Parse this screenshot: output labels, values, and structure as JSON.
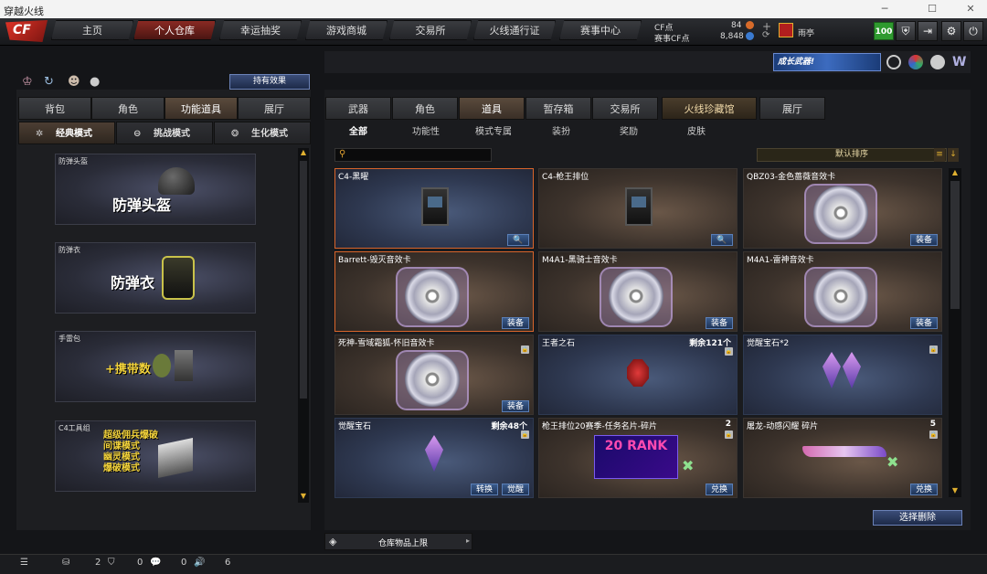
{
  "window": {
    "title": "穿越火线"
  },
  "nav": {
    "tabs": [
      "主页",
      "个人仓库",
      "幸运抽奖",
      "游戏商城",
      "交易所",
      "火线通行证",
      "赛事中心"
    ],
    "active": 1
  },
  "currency": {
    "cf_label": "CF点",
    "cf_value": "84",
    "match_label": "赛事CF点",
    "match_value": "8,848"
  },
  "user": {
    "name": "雨亭",
    "level": "100"
  },
  "left": {
    "effect_button": "持有效果",
    "tabs": [
      "背包",
      "角色",
      "功能道具",
      "展厅"
    ],
    "active_tab": 2,
    "modes": [
      "经典模式",
      "挑战模式",
      "生化模式"
    ],
    "cards": [
      {
        "caption": "防弹头盔",
        "title": "防弹头盔"
      },
      {
        "caption": "防弹衣",
        "title": "防弹衣"
      },
      {
        "caption": "手雷包",
        "title": "+携带数"
      },
      {
        "caption": "C4工具组",
        "lines": [
          "超级佣兵爆破",
          "间谍模式",
          "幽灵模式",
          "爆破模式"
        ]
      }
    ]
  },
  "banner": {
    "text": "成长武器!"
  },
  "right": {
    "tabs": [
      "武器",
      "角色",
      "道具",
      "暂存箱",
      "交易所",
      "火线珍藏馆",
      "展厅"
    ],
    "active_tab": 2,
    "subtabs": [
      "全部",
      "功能性",
      "模式专属",
      "装扮",
      "奖励",
      "皮肤"
    ],
    "search_placeholder": "",
    "sort_label": "默认排序",
    "items": [
      {
        "name": "C4-黑曜",
        "qty": "",
        "btn": [
          "🔍"
        ]
      },
      {
        "name": "C4-枪王排位",
        "qty": "",
        "btn": [
          "🔍"
        ]
      },
      {
        "name": "QBZ03-金色蔷薇音效卡",
        "qty": "",
        "btn": [
          "装备"
        ]
      },
      {
        "name": "Barrett-毁灭音效卡",
        "qty": "",
        "btn": [
          "装备"
        ]
      },
      {
        "name": "M4A1-黑骑士音效卡",
        "qty": "",
        "btn": [
          "装备"
        ]
      },
      {
        "name": "M4A1-雷神音效卡",
        "qty": "",
        "btn": [
          "装备"
        ]
      },
      {
        "name": "死神-雪域霜狐-怀旧音效卡",
        "qty": "",
        "btn": [
          "装备"
        ]
      },
      {
        "name": "王者之石",
        "qty": "剩余121个",
        "btn": []
      },
      {
        "name": "觉醒宝石*2",
        "qty": "",
        "btn": []
      },
      {
        "name": "觉醒宝石",
        "qty": "剩余48个",
        "btn": [
          "转换",
          "觉醒"
        ]
      },
      {
        "name": "枪王排位20赛季-任务名片-碎片",
        "qty": "2",
        "btn": [
          "兑换"
        ],
        "art": "20 RANK"
      },
      {
        "name": "屠龙-动感闪耀 碎片",
        "qty": "5",
        "btn": [
          "兑换"
        ]
      }
    ],
    "delete_button": "选择删除",
    "capacity_label": "仓库物品上限"
  },
  "status": {
    "a": "2",
    "b": "0",
    "c": "0",
    "d": "6"
  },
  "colors": {
    "accent": "#d9652b",
    "nav_active": "#8a2a23",
    "button_blue": "#3a5b8c"
  }
}
